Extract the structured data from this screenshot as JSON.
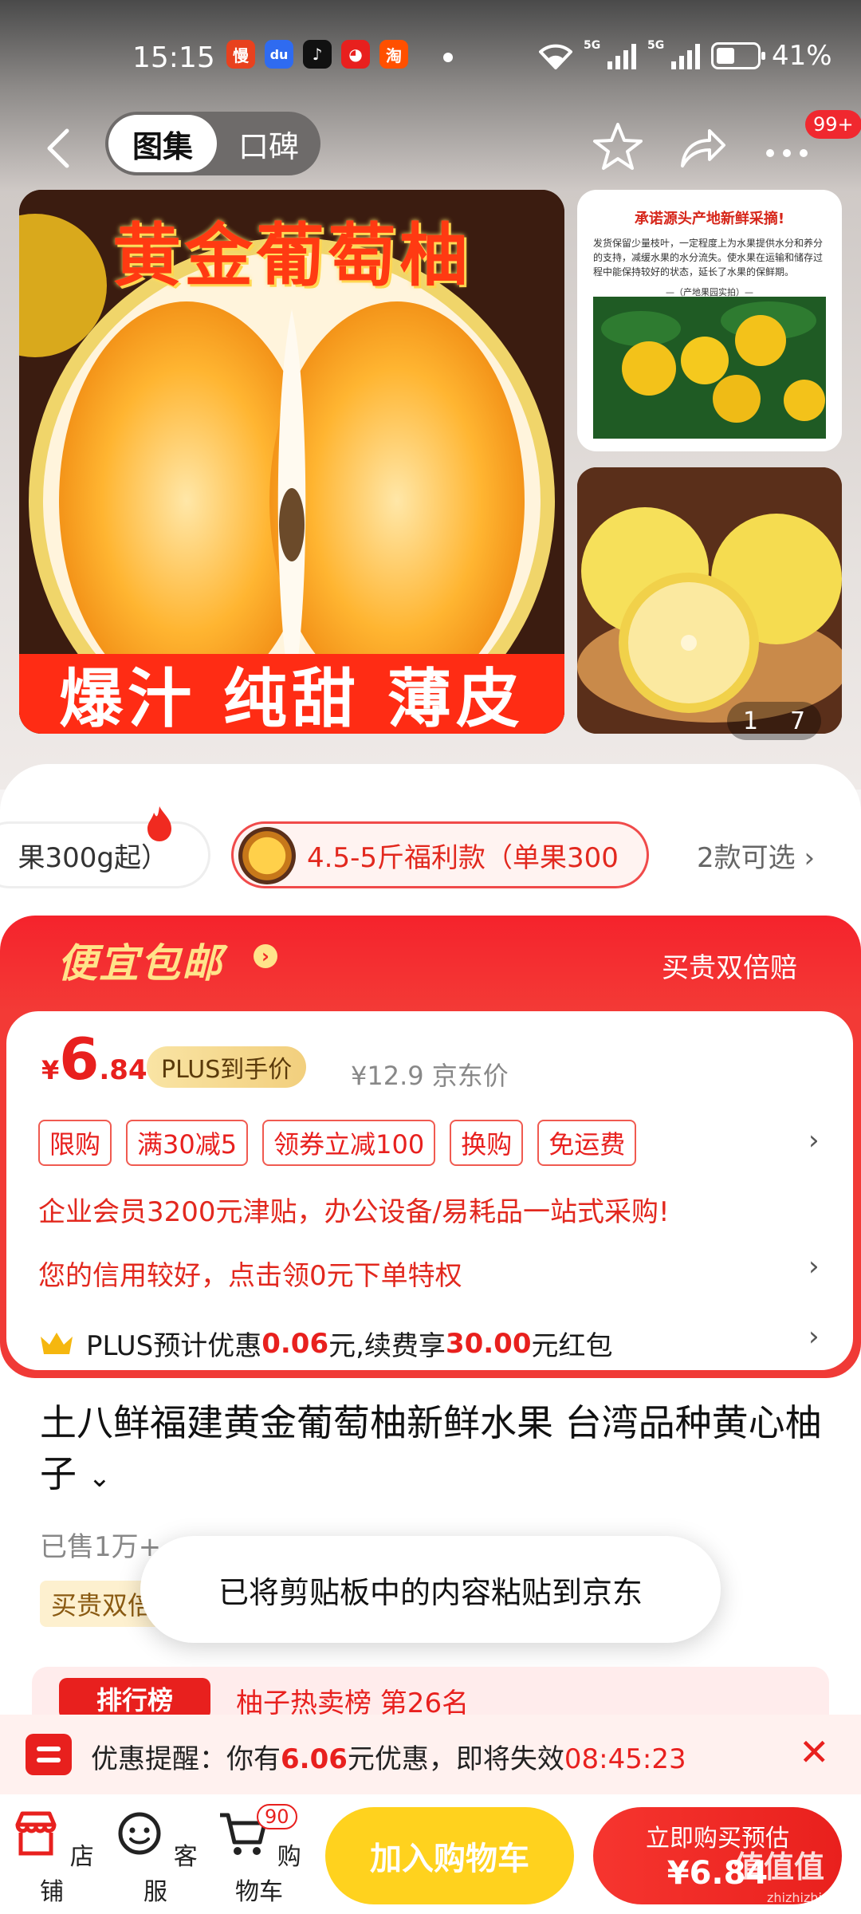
{
  "status_bar": {
    "time": "15:15",
    "app_icons": [
      {
        "name": "manhua-app-icon",
        "glyph": "慢",
        "color": "#e8411e"
      },
      {
        "name": "baidu-app-icon",
        "glyph": "du",
        "color": "#2f6bf0"
      },
      {
        "name": "douyin-app-icon",
        "glyph": "♪",
        "color": "#111111"
      },
      {
        "name": "jd-app-icon",
        "glyph": "◕",
        "color": "#e8201e"
      },
      {
        "name": "taobao-app-icon",
        "glyph": "淘",
        "color": "#ff5000"
      }
    ],
    "network_1": "5G",
    "network_2": "5G",
    "battery": "41%"
  },
  "nav": {
    "tab_active": "图集",
    "tab_inactive": "口碑",
    "badge": "99+"
  },
  "gallery": {
    "main_title": "黄金葡萄柚",
    "main_bottom": "爆汁 纯甜 薄皮",
    "side_heading": "承诺源头产地新鲜采摘!",
    "side_text": "发货保留少量枝叶，一定程度上为水果提供水分和养分的支持，减缓水果的水分流失。使水果在运输和储存过程中能保持较好的状态，延长了水果的保鲜期。",
    "side_caption": "—（产地果园实拍）—",
    "pager_current": "1",
    "pager_total": "7"
  },
  "variants": {
    "option_1": "果300g起）",
    "option_2": "4.5-5斤福利款（单果300",
    "more": "2款可选"
  },
  "promo": {
    "title": "便宜包邮",
    "right_text": "买贵双倍赔",
    "currency": "¥",
    "price_int": "6",
    "price_dec": ".84",
    "plus_tag": "PLUS到手价",
    "orig_price": "¥12.9 京东价",
    "tags": [
      "限购",
      "满30减5",
      "领券立减100",
      "换购",
      "免运费"
    ],
    "enterprise_line": "企业会员3200元津贴，办公设备/易耗品一站式采购!",
    "credit_line": "您的信用较好，点击领0元下单特权",
    "plus_line_1": "PLUS预计优惠",
    "plus_line_2": "0.06",
    "plus_line_3": "元,续费享",
    "plus_line_4": "30.00",
    "plus_line_5": "元红包"
  },
  "product": {
    "title": "土八鲜福建黄金葡萄柚新鲜水果 台湾品种黄心柚子",
    "sold": "已售1万+",
    "guarantee": "买贵双倍赔"
  },
  "toast": "已将剪贴板中的内容粘贴到京东",
  "rank": {
    "label": "排行榜",
    "text": "柚子热卖榜 第26名"
  },
  "reminder": {
    "text_1": "优惠提醒：你有",
    "amount": "6.06",
    "text_2": "元优惠，即将失效",
    "countdown": "08:45:23"
  },
  "bottom_bar": {
    "shop": "店铺",
    "service": "客服",
    "cart": "购物车",
    "cart_count": "90",
    "add_to_cart": "加入购物车",
    "buy_now": "立即购买预估",
    "buy_price": "¥6.84"
  },
  "watermark": {
    "main": "值值值",
    "url": "zhizhizhi.com"
  }
}
